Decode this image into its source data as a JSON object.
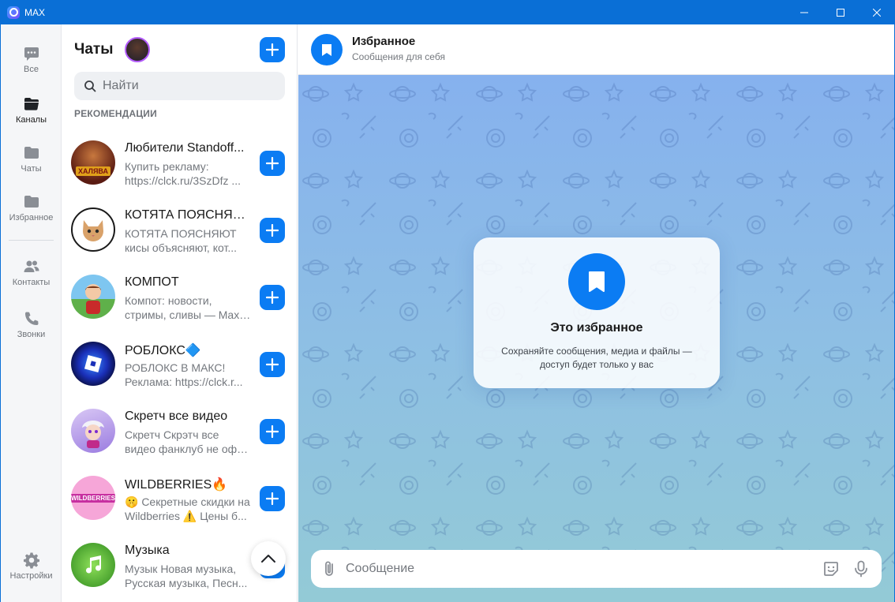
{
  "window": {
    "title": "MAX"
  },
  "rail": {
    "items": [
      {
        "label": "Все",
        "icon": "chat-bubble-icon"
      },
      {
        "label": "Каналы",
        "icon": "folder-icon",
        "active": true
      },
      {
        "label": "Чаты",
        "icon": "folder-icon"
      },
      {
        "label": "Избранное",
        "icon": "folder-icon"
      },
      {
        "label": "Контакты",
        "icon": "contacts-icon"
      },
      {
        "label": "Звонки",
        "icon": "phone-icon"
      },
      {
        "label": "Настройки",
        "icon": "gear-icon"
      }
    ]
  },
  "list": {
    "title": "Чаты",
    "search_placeholder": "Найти",
    "section": "РЕКОМЕНДАЦИИ",
    "chats": [
      {
        "name": "Любители Standoff...",
        "line1": "Купить рекламу:",
        "line2": "https://clck.ru/3SzDfz ...",
        "avatar_badge": "ХАЛЯВА"
      },
      {
        "name": "КОТЯТА ПОЯСНЯЮТ",
        "line1": "КОТЯТА ПОЯСНЯЮТ",
        "line2": "кисы объясняют, кот..."
      },
      {
        "name": "КОМПОТ",
        "line1": "Компот: новости,",
        "line2": "стримы, сливы — Max-..."
      },
      {
        "name": "РОБЛОКС🔷",
        "line1": "РОБЛОКС В МАКС!",
        "line2": "Реклама: https://clck.r..."
      },
      {
        "name": "Скретч все видео",
        "line1": "Скретч Скрэтч все",
        "line2": "видео фанклуб не офи..."
      },
      {
        "name": "WILDBERRIES🔥",
        "line1": "🤫 Секретные скидки на",
        "line2": "Wildberries ⚠️ Цены б...",
        "avatar_badge": "WILDBERRIES"
      },
      {
        "name": "Музыка",
        "line1": "Музык Новая музыка,",
        "line2": "Русская музыка, Песн..."
      }
    ]
  },
  "chat": {
    "title": "Избранное",
    "subtitle": "Сообщения для себя",
    "card_title": "Это избранное",
    "card_text_1": "Сохраняйте сообщения, медиа и файлы —",
    "card_text_2": "доступ будет только у вас",
    "composer_placeholder": "Сообщение"
  },
  "colors": {
    "accent": "#0b7cf3",
    "titlebar": "#0a6fd6"
  }
}
